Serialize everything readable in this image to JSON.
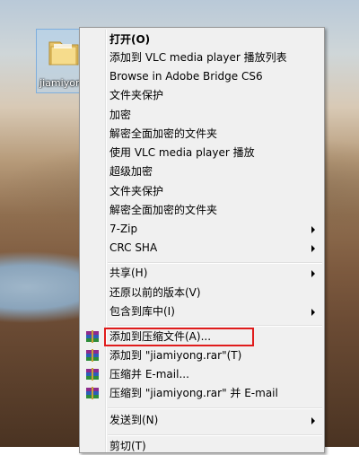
{
  "desktop": {
    "icon_label": "jiamiyong"
  },
  "menu": {
    "items": [
      {
        "label": "打开(O)"
      },
      {
        "label": "添加到 VLC media player 播放列表"
      },
      {
        "label": "Browse in Adobe Bridge CS6"
      },
      {
        "label": "文件夹保护"
      },
      {
        "label": "加密"
      },
      {
        "label": "解密全面加密的文件夹"
      },
      {
        "label": "使用 VLC media player 播放"
      },
      {
        "label": "超级加密"
      },
      {
        "label": "文件夹保护"
      },
      {
        "label": "解密全面加密的文件夹"
      },
      {
        "label": "7-Zip"
      },
      {
        "label": "CRC SHA"
      },
      {
        "label": "共享(H)"
      },
      {
        "label": "还原以前的版本(V)"
      },
      {
        "label": "包含到库中(I)"
      },
      {
        "label": "添加到压缩文件(A)..."
      },
      {
        "label": "添加到 \"jiamiyong.rar\"(T)"
      },
      {
        "label": "压缩并 E-mail..."
      },
      {
        "label": "压缩到 \"jiamiyong.rar\" 并 E-mail"
      },
      {
        "label": "发送到(N)"
      },
      {
        "label": "剪切(T)"
      }
    ],
    "highlight_color": "#e01c1c",
    "icons": {
      "winrar": "winrar-icon",
      "submenu": "chevron-right-icon"
    }
  }
}
